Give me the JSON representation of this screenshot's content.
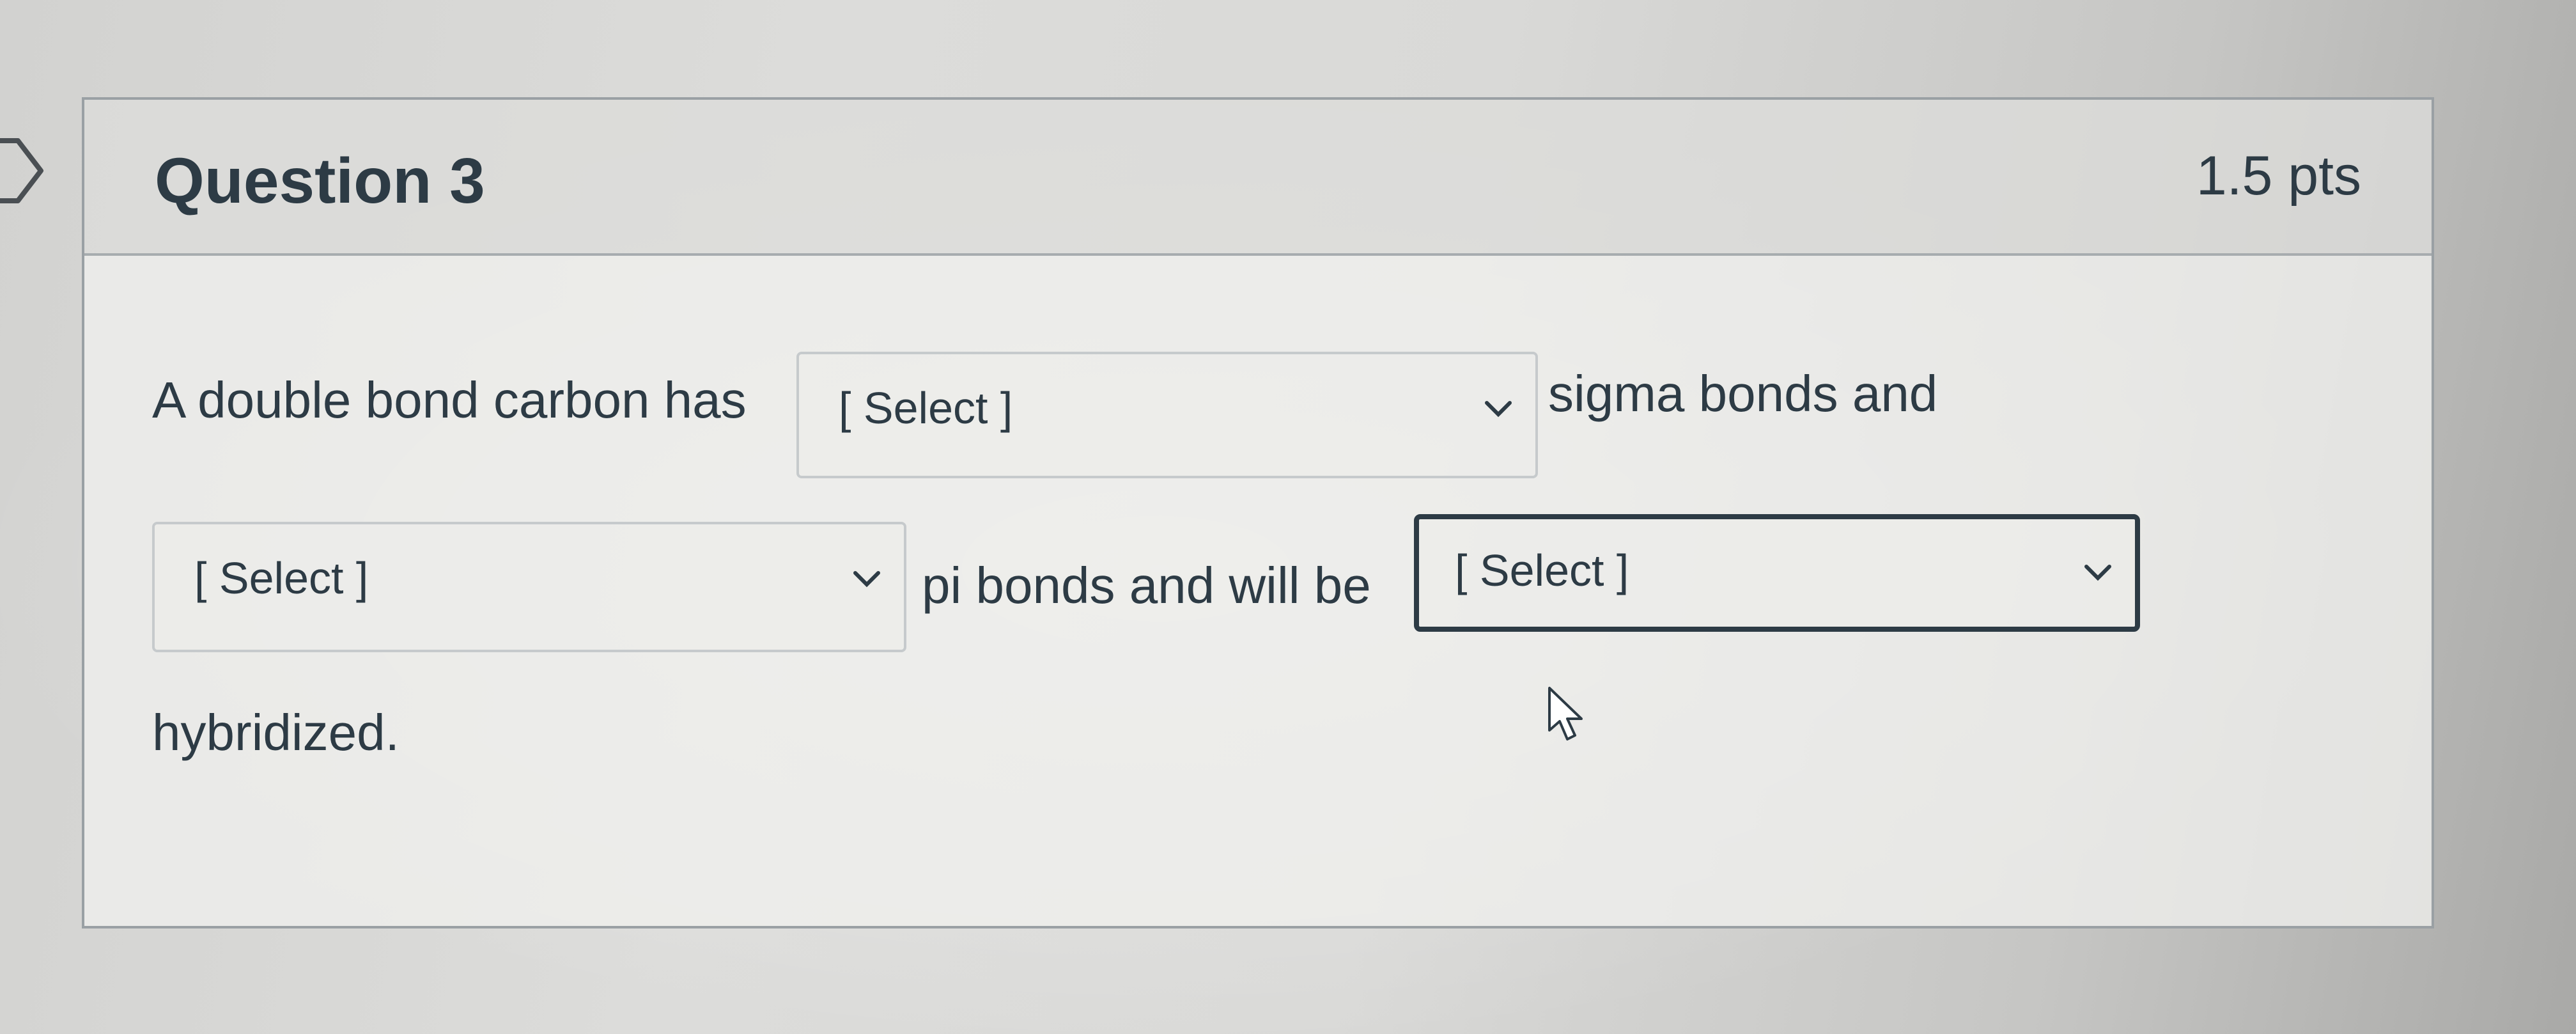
{
  "question": {
    "title": "Question 3",
    "points": "1.5 pts"
  },
  "body": {
    "text_1": "A double bond carbon has",
    "text_2": "sigma bonds and",
    "text_3": "pi bonds and will be",
    "text_4": "hybridized."
  },
  "selects": [
    {
      "value": "[ Select ]",
      "focused": false
    },
    {
      "value": "[ Select ]",
      "focused": false
    },
    {
      "value": "[ Select ]",
      "focused": true
    }
  ],
  "icons": {
    "nav": "chevron-right-outline-icon",
    "dropdown": "chevron-down-icon",
    "cursor": "mouse-pointer-icon"
  },
  "colors": {
    "text": "#2d3b45",
    "border": "#9aa0a4",
    "select_border": "#c6cacc",
    "focus_border": "#2d3b45"
  }
}
